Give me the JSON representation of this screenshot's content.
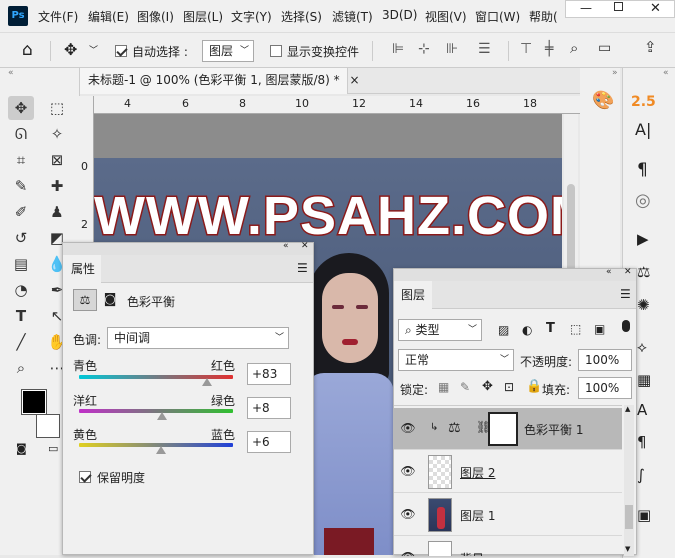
{
  "app": {
    "logo": "Ps"
  },
  "menu": [
    "文件(F)",
    "编辑(E)",
    "图像(I)",
    "图层(L)",
    "文字(Y)",
    "选择(S)",
    "滤镜(T)",
    "3D(D)",
    "视图(V)",
    "窗口(W)",
    "帮助("
  ],
  "options": {
    "auto_select_label": "自动选择 :",
    "auto_select_value": "图层",
    "show_transform_label": "显示变换控件"
  },
  "document": {
    "tab_title": "未标题-1 @ 100% (色彩平衡 1, 图层蒙版/8) *",
    "close": "×"
  },
  "ruler": {
    "h_ticks": [
      "4",
      "6",
      "8",
      "10",
      "12",
      "14",
      "16",
      "18"
    ],
    "v_ticks": [
      "0",
      "2"
    ]
  },
  "canvas": {
    "watermark": "WWW.PSAHZ.COM"
  },
  "right_strip": {
    "char_size": "2.5",
    "char_icon": "A|",
    "para_icon": "¶"
  },
  "properties": {
    "tab": "属性",
    "adjustment_name": "色彩平衡",
    "tone_label": "色调:",
    "tone_value": "中间调",
    "sliders": [
      {
        "left": "青色",
        "right": "红色",
        "value": "+83",
        "fraction": 0.83
      },
      {
        "left": "洋红",
        "right": "绿色",
        "value": "+8",
        "fraction": 0.54
      },
      {
        "left": "黄色",
        "right": "蓝色",
        "value": "+6",
        "fraction": 0.53
      }
    ],
    "preserve_label": "保留明度"
  },
  "layers": {
    "tab": "图层",
    "filter_kind": "类型",
    "blend_mode": "正常",
    "opacity_label": "不透明度:",
    "opacity_value": "100%",
    "lock_label": "锁定:",
    "fill_label": "填充:",
    "fill_value": "100%",
    "rows": [
      {
        "name": "色彩平衡 1",
        "selected": true
      },
      {
        "name": "图层 2",
        "selected": false
      },
      {
        "name": "图层 1",
        "selected": false
      },
      {
        "name": "背景",
        "selected": false
      }
    ]
  },
  "colors": {
    "accent": "#31a8ff",
    "selected_row": "#b8b8b8",
    "watermark_fill": "#ffffff",
    "watermark_stroke": "#8b1a1a"
  }
}
